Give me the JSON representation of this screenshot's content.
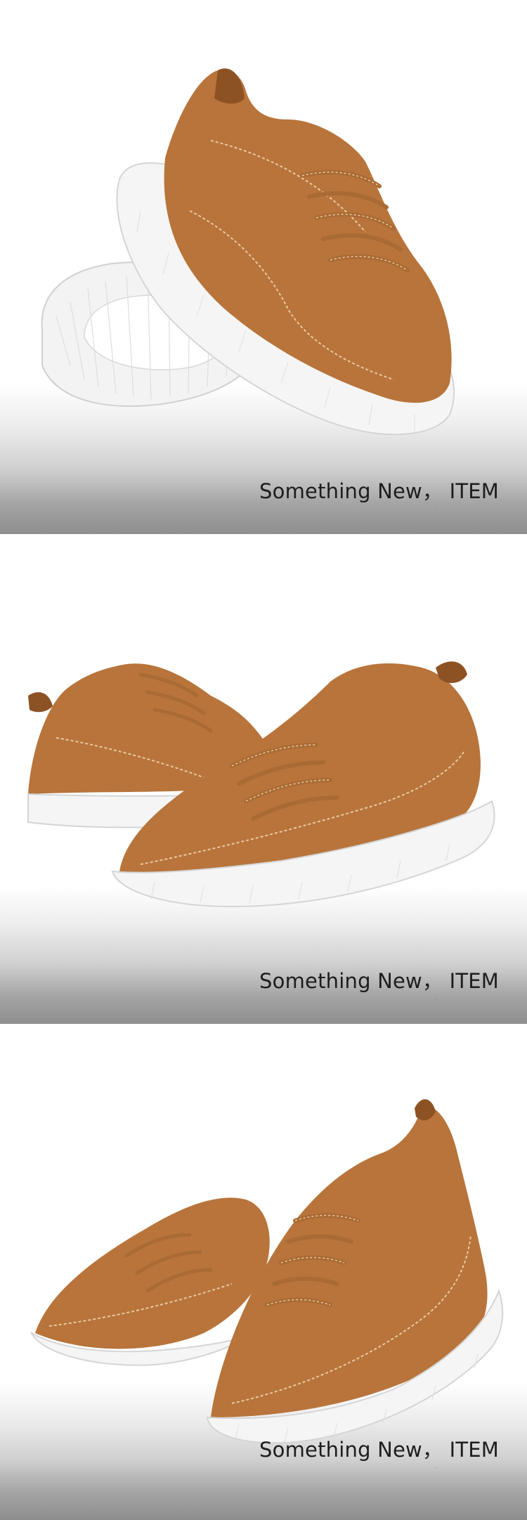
{
  "colors": {
    "suede": "#b8743b",
    "suede_dark": "#8d5224",
    "sole": "#f4f4f4",
    "stitch": "#e9c9a0",
    "caption_text": "#1d1d1d"
  },
  "panels": [
    {
      "image": "shoe-pair-sole-view",
      "caption": {
        "title": "Something New， ITEM",
        "fine_print": "..."
      }
    },
    {
      "image": "shoe-pair-side-view",
      "caption": {
        "title": "Something New， ITEM",
        "fine_print": "..."
      }
    },
    {
      "image": "shoe-pair-angled-view",
      "caption": {
        "title": "Something New， ITEM",
        "fine_print": "..."
      }
    }
  ]
}
